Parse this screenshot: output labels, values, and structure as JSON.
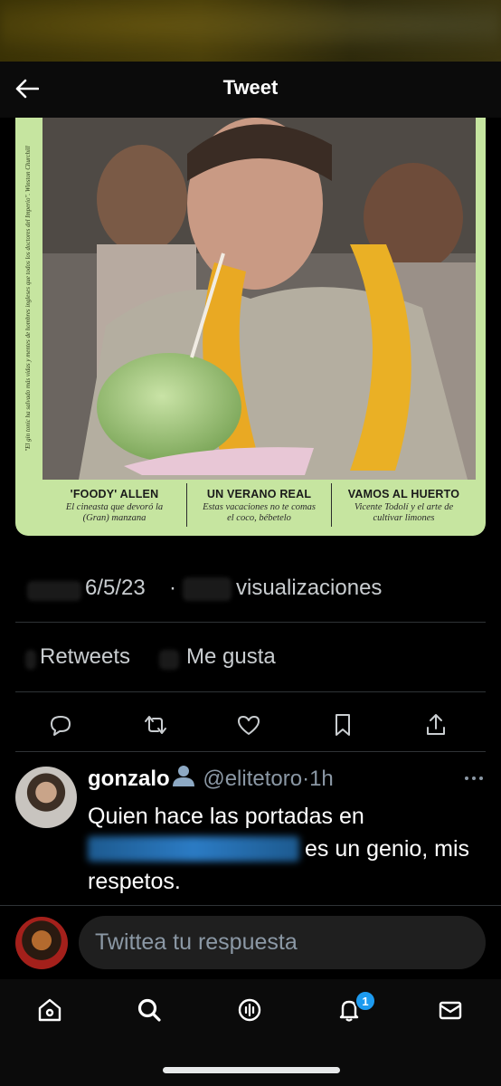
{
  "header": {
    "title": "Tweet"
  },
  "magazine": {
    "side_quote": "\"El gin tonic ha salvado más vidas y mentes de hombres ingleses que todos los doctores del Imperio\". Winston Churchill",
    "captions": [
      {
        "title": "'FOODY' ALLEN",
        "subtitle": "El cineasta que devoró la (Gran) manzana"
      },
      {
        "title": "UN VERANO REAL",
        "subtitle": "Estas vacaciones no te comas el coco, bébetelo"
      },
      {
        "title": "VAMOS AL HUERTO",
        "subtitle": "Vicente Todolí y el arte de cultivar limones"
      }
    ]
  },
  "meta": {
    "date": "6/5/23",
    "separator": "·",
    "views_label": "visualizaciones"
  },
  "stats": {
    "retweets_label": "Retweets",
    "likes_label": "Me gusta"
  },
  "reply": {
    "name": "gonzalo",
    "handle": "@elitetoro",
    "separator": "·",
    "time": "1h",
    "text_after_mention": "es un genio, mis respetos.",
    "text_before_mention": "Quien hace las portadas en"
  },
  "compose": {
    "placeholder": "Twittea tu respuesta"
  },
  "tabbar": {
    "notifications_badge": "1"
  },
  "colors": {
    "accent": "#1d9bf0",
    "magazine_green": "#c6e5a0"
  }
}
